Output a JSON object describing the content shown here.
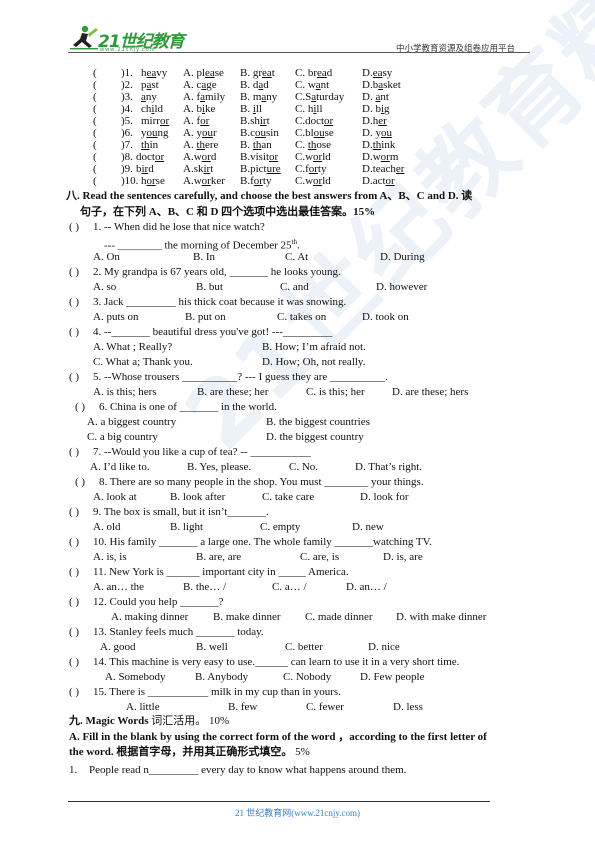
{
  "header": {
    "logo_text": "21世纪教育",
    "logo_url": "www.21cnjy.com",
    "platform": "中小学教育资源及组卷应用平台"
  },
  "watermark": "21世纪教育精选资料",
  "phonetics": [
    {
      "num": ")1. ",
      "words": [
        [
          "h",
          "ea",
          "vy"
        ],
        [
          "A. pl",
          "ea",
          "se"
        ],
        [
          "B. gr",
          "ea",
          "t"
        ],
        [
          "C. br",
          "ea",
          "d"
        ],
        [
          "D.",
          "ea",
          "sy"
        ]
      ]
    },
    {
      "num": ")2. ",
      "words": [
        [
          "p",
          "a",
          "st"
        ],
        [
          "A. c",
          "a",
          "ge"
        ],
        [
          "B. d",
          "a",
          "d"
        ],
        [
          "C. w",
          "a",
          "nt"
        ],
        [
          "D.b",
          "a",
          "sket"
        ]
      ]
    },
    {
      "num": ")3. ",
      "words": [
        [
          "",
          "a",
          "ny"
        ],
        [
          "A. f",
          "a",
          "mily"
        ],
        [
          "B. m",
          "a",
          "ny"
        ],
        [
          "C.S",
          "a",
          "turday"
        ],
        [
          "D. ",
          "a",
          "nt"
        ]
      ]
    },
    {
      "num": ")4. ",
      "words": [
        [
          "ch",
          "i",
          "ld"
        ],
        [
          "A. b",
          "i",
          "ke"
        ],
        [
          "B. ",
          "i",
          "ll"
        ],
        [
          "C. h",
          "i",
          "ll"
        ],
        [
          "D. b",
          "i",
          "g"
        ]
      ]
    },
    {
      "num": ")5. ",
      "words": [
        [
          "mirr",
          "or",
          ""
        ],
        [
          "A. f",
          "or",
          ""
        ],
        [
          "B.sh",
          "ir",
          "t"
        ],
        [
          "C.doct",
          "or",
          ""
        ],
        [
          "D.h",
          "er",
          ""
        ]
      ]
    },
    {
      "num": ")6. ",
      "words": [
        [
          "y",
          "ou",
          "ng"
        ],
        [
          "A. y",
          "ou",
          "r"
        ],
        [
          "B.c",
          "ou",
          "sin"
        ],
        [
          "C.bl",
          "ou",
          "se"
        ],
        [
          "D. y",
          "ou",
          ""
        ]
      ]
    },
    {
      "num": ")7. ",
      "words": [
        [
          "",
          "th",
          "in"
        ],
        [
          "A. ",
          "th",
          "ere"
        ],
        [
          "B. ",
          "th",
          "an"
        ],
        [
          "C. ",
          "th",
          "ose"
        ],
        [
          "D.",
          "th",
          "ink"
        ]
      ]
    },
    {
      "num": ")8.",
      "words": [
        [
          "doct",
          "or",
          ""
        ],
        [
          "A.w",
          "or",
          "d"
        ],
        [
          "B.visit",
          "or",
          ""
        ],
        [
          "C.w",
          "or",
          "ld"
        ],
        [
          "D.w",
          "or",
          "m"
        ]
      ]
    },
    {
      "num": ")9.",
      "words": [
        [
          "b",
          "ir",
          "d"
        ],
        [
          "A.sk",
          "ir",
          "t"
        ],
        [
          "B.pict",
          "ure",
          ""
        ],
        [
          "C.f",
          "or",
          "ty"
        ],
        [
          "D.teach",
          "er",
          ""
        ]
      ]
    },
    {
      "num": ")10.",
      "words": [
        [
          "h",
          "or",
          "se"
        ],
        [
          "A.w",
          "or",
          "ker"
        ],
        [
          "B.f",
          "or",
          "ty"
        ],
        [
          "C.w",
          "or",
          "ld"
        ],
        [
          "D.act",
          "or",
          ""
        ]
      ]
    }
  ],
  "section8": {
    "title_line1": "八.  Read the sentences carefully, and choose the best answers from A、B、C and D. 读",
    "title_line2": "句子，在下列 A、B、C 和 D 四个选项中选出最佳答案。15%",
    "questions": [
      {
        "stem": "1. -- When did he lose that nice watch?",
        "stem2": "---    ________ the morning of December 25",
        "stem2_sup": "th",
        "stem2_end": ".",
        "options": [
          "A. On",
          "B. In",
          "C. At",
          "D. During"
        ]
      },
      {
        "stem": "2. My grandpa is 67 years old, _______ he looks young.",
        "options": [
          "A. so",
          "B. but",
          "C. and",
          "D. however"
        ]
      },
      {
        "stem": "3. Jack _________ his thick coat because it was snowing.",
        "options": [
          "A. puts on",
          "B. put on",
          "C. takes on",
          "D. took on"
        ]
      },
      {
        "stem": "4. --_______     beautiful dress you've got!      ---_________",
        "options": [
          "A. What ; Really?",
          "B. How; I’m afraid not.",
          "C. What a; Thank you.",
          "D. How; Oh, not really."
        ]
      },
      {
        "stem": "5. --Whose trousers __________?   --- I guess they are __________.",
        "options": [
          "A. is this; hers",
          "B. are these; her",
          "C. is this; her",
          "D. are these; hers"
        ]
      },
      {
        "stem": "6. China is one of _______ in the world.",
        "options": [
          "A. a biggest country",
          "B. the biggest countries",
          "C. a big country",
          "D. the biggest country"
        ]
      },
      {
        "stem": "7. --Would you like a cup of tea?          -- ___________",
        "options": [
          "A.  I’d like to.",
          "B. Yes, please.",
          "C. No.",
          "D. That’s right."
        ]
      },
      {
        "stem": "8. There are so many people in the shop. You must ________ your things.",
        "options": [
          "A. look at",
          "B. look after",
          "C. take care",
          "D. look for"
        ]
      },
      {
        "stem": "9. The box is small, but it isn’t_______.",
        "options": [
          "A. old",
          "B. light",
          "C. empty",
          "D. new"
        ]
      },
      {
        "stem": "10. His family _______ a large one. The whole family _______watching TV.",
        "options": [
          "A. is, is",
          "B. are, are",
          "C. are, is",
          "D. is, are"
        ]
      },
      {
        "stem": "11. New York is ______ important city in _____ America.",
        "options": [
          "A. an… the",
          "B. the… /",
          "C. a… /",
          "D. an… /"
        ]
      },
      {
        "stem": "12. Could you help _______?",
        "options": [
          "A. making dinner",
          "B. make dinner",
          "C. made dinner",
          "D. with make dinner"
        ]
      },
      {
        "stem": "13. Stanley feels much _______ today.",
        "options": [
          "A.  good",
          "B. well",
          "C. better",
          "D. nice"
        ]
      },
      {
        "stem": "14. This machine is very easy to use.______ can learn to use it in a very short time.",
        "options": [
          "A. Somebody",
          "B. Anybody",
          "C. Nobody",
          "D. Few people"
        ]
      },
      {
        "stem": "15. There is ___________ milk in my cup than in yours.",
        "options": [
          "A.  little",
          "B. few",
          "C. fewer",
          "D. less"
        ]
      }
    ]
  },
  "section9": {
    "title_bold": "九.  Magic Words",
    "title_rest": " 词汇活用。 10%",
    "partA_line1": "A. Fill in the blank by using the correct form of the word  ，according to the first letter of",
    "partA_line2_bold": "the word. 根据首字母，并用其正确形式填空。",
    "partA_line2_rest": "  5%",
    "q1_num": "1.",
    "q1_text": "People read n_________ every day to know what happens around them."
  },
  "footer": {
    "text": "21 世纪教育网(www.21cnjy.com)"
  }
}
